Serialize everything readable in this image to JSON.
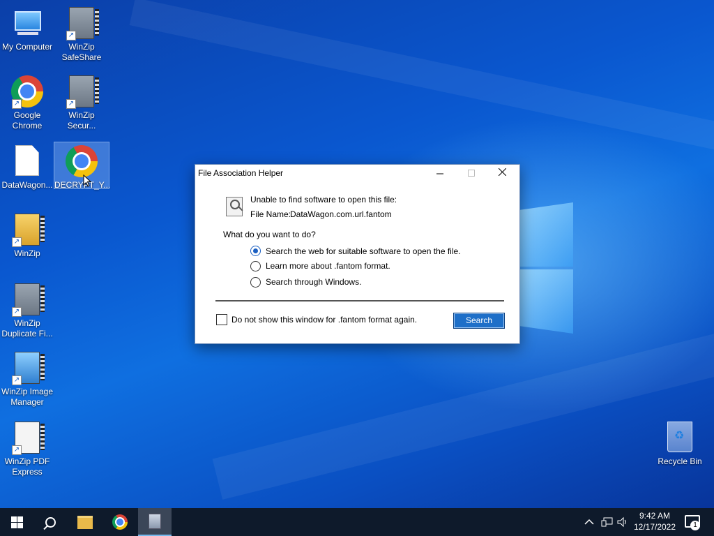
{
  "desktop": {
    "icons": [
      {
        "label": "My Computer",
        "icon": "computer-icon"
      },
      {
        "label": "WinZip SafeShare",
        "icon": "winzip-safeshare-icon"
      },
      {
        "label": "Google Chrome",
        "icon": "chrome-icon"
      },
      {
        "label": "WinZip Secur...",
        "icon": "winzip-secure-icon"
      },
      {
        "label": "DataWagon...",
        "icon": "file-icon"
      },
      {
        "label": "DECRYPT_Y...",
        "icon": "chrome-icon"
      },
      {
        "label": "WinZip",
        "icon": "winzip-icon"
      },
      {
        "label": "WinZip Duplicate Fi...",
        "icon": "winzip-duplicate-icon"
      },
      {
        "label": "WinZip Image Manager",
        "icon": "winzip-image-icon"
      },
      {
        "label": "WinZip PDF Express",
        "icon": "winzip-pdf-icon"
      },
      {
        "label": "Recycle Bin",
        "icon": "recycle-bin-icon"
      }
    ]
  },
  "dialog": {
    "title": "File Association Helper",
    "message": "Unable to find software to open this file:",
    "file_name_label": "File Name:",
    "file_name": "DataWagon.com.url.fantom",
    "question": "What do you want to do?",
    "options": [
      {
        "label": "Search the web for suitable software to open the file.",
        "checked": true
      },
      {
        "label": "Learn more about .fantom format.",
        "checked": false
      },
      {
        "label": "Search through Windows.",
        "checked": false
      }
    ],
    "dont_show_label": "Do not show this window for .fantom format again.",
    "search_button": "Search"
  },
  "taskbar": {
    "time": "9:42 AM",
    "date": "12/17/2022",
    "notification_count": "1"
  },
  "colors": {
    "accent": "#1e6fc8",
    "taskbar": "#0e1a2b"
  }
}
